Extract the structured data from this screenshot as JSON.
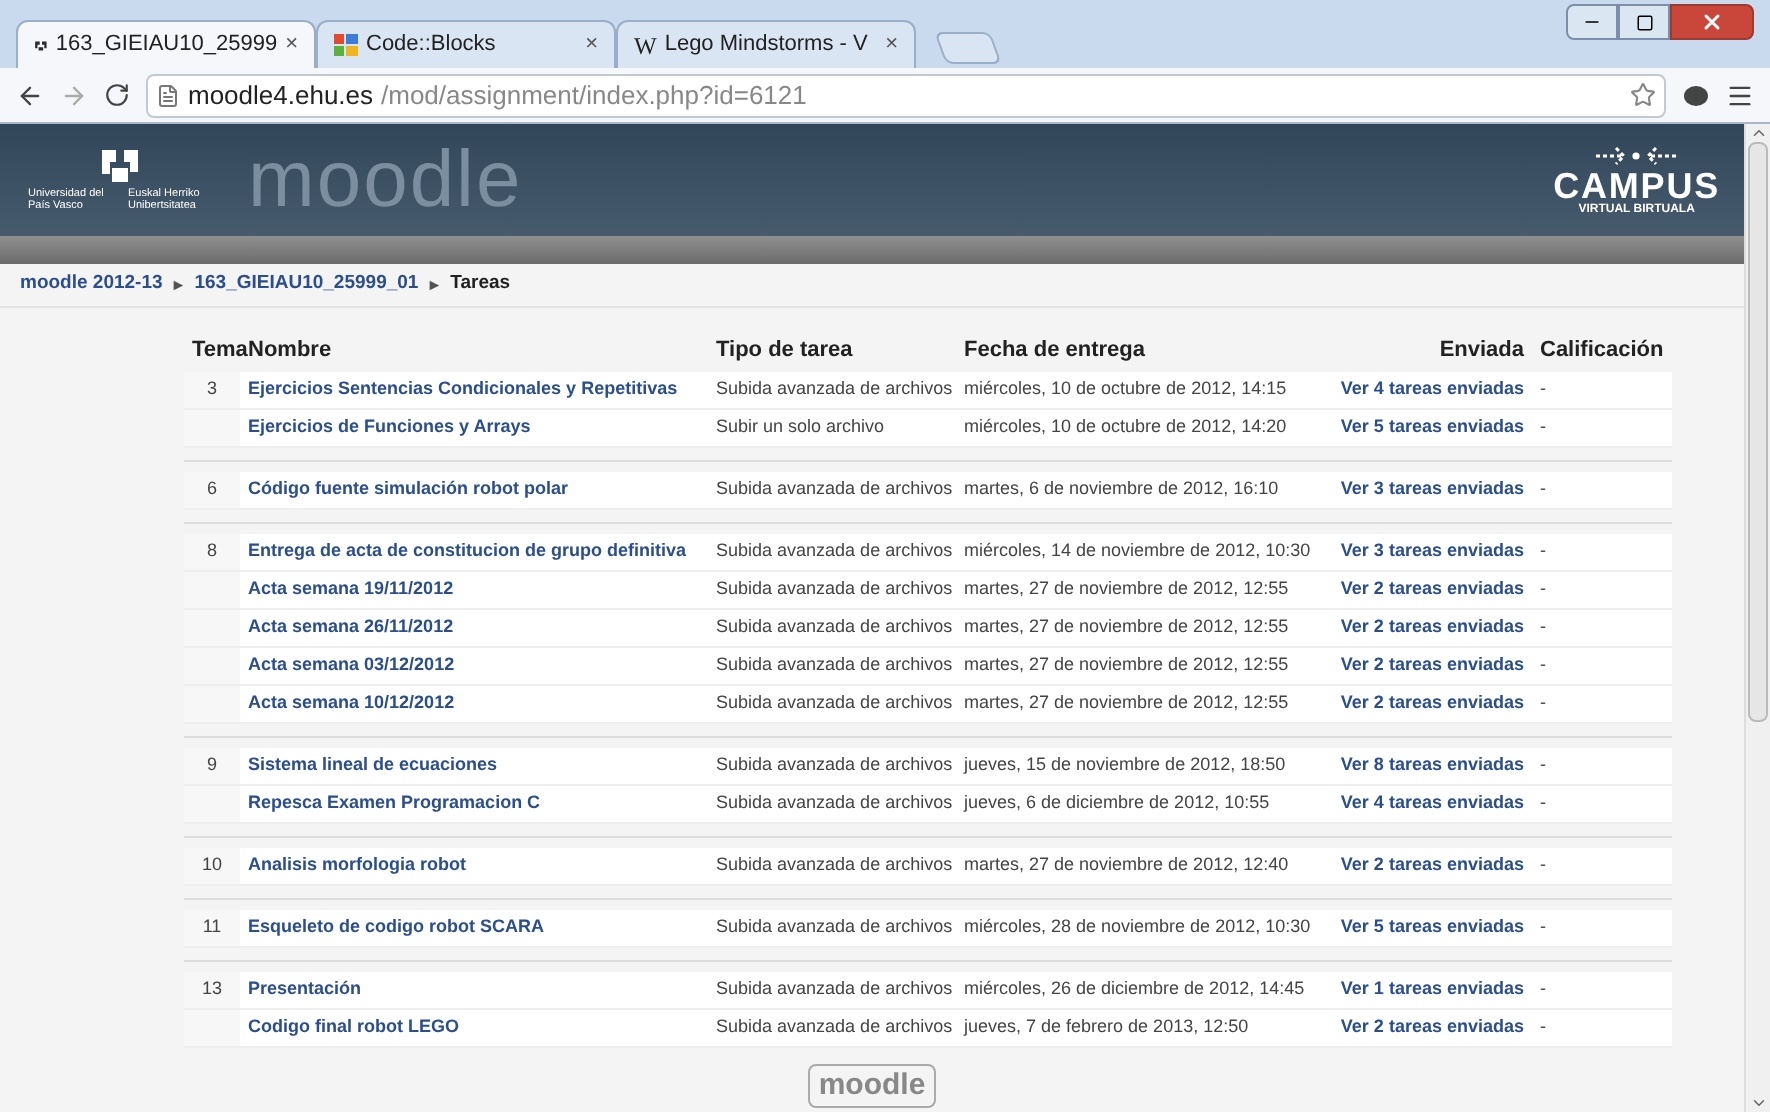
{
  "browser": {
    "tabs": [
      {
        "title": "163_GIEIAU10_25999",
        "close": "×",
        "selected": true,
        "kind": "moodle"
      },
      {
        "title": "Code::Blocks",
        "close": "×",
        "selected": false,
        "kind": "grid"
      },
      {
        "title": "Lego Mindstorms - V",
        "close": "×",
        "selected": false,
        "kind": "wiki"
      }
    ],
    "wiki_glyph": "W",
    "url_host": "moodle4.ehu.es",
    "url_path": "/mod/assignment/index.php?id=6121"
  },
  "header": {
    "university": [
      "Universidad del País Vasco",
      "Euskal Herriko Unibertsitatea"
    ],
    "site_name": "moodle",
    "campus": "CAMPUS",
    "campus_sub": "VIRTUAL BIRTUALA"
  },
  "breadcrumb": {
    "separator": "►",
    "items": [
      "moodle 2012-13",
      "163_GIEIAU10_25999_01",
      "Tareas"
    ]
  },
  "table": {
    "columns": [
      "Tema",
      "Nombre",
      "Tipo de tarea",
      "Fecha de entrega",
      "Enviada",
      "Calificación"
    ],
    "sections": [
      {
        "tema": "3",
        "rows": [
          {
            "name": "Ejercicios Sentencias Condicionales y Repetitivas",
            "type": "Subida avanzada de archivos",
            "due": "miércoles, 10 de octubre de 2012, 14:15",
            "sent": "Ver 4 tareas enviadas",
            "grade": "-"
          },
          {
            "name": "Ejercicios de Funciones y Arrays",
            "type": "Subir un solo archivo",
            "due": "miércoles, 10 de octubre de 2012, 14:20",
            "sent": "Ver 5 tareas enviadas",
            "grade": "-"
          }
        ]
      },
      {
        "tema": "6",
        "rows": [
          {
            "name": "Código fuente simulación robot polar",
            "type": "Subida avanzada de archivos",
            "due": "martes, 6 de noviembre de 2012, 16:10",
            "sent": "Ver 3 tareas enviadas",
            "grade": "-"
          }
        ]
      },
      {
        "tema": "8",
        "rows": [
          {
            "name": "Entrega de acta de constitucion de grupo definitiva",
            "type": "Subida avanzada de archivos",
            "due": "miércoles, 14 de noviembre de 2012, 10:30",
            "sent": "Ver 3 tareas enviadas",
            "grade": "-"
          },
          {
            "name": "Acta semana 19/11/2012",
            "type": "Subida avanzada de archivos",
            "due": "martes, 27 de noviembre de 2012, 12:55",
            "sent": "Ver 2 tareas enviadas",
            "grade": "-"
          },
          {
            "name": "Acta semana 26/11/2012",
            "type": "Subida avanzada de archivos",
            "due": "martes, 27 de noviembre de 2012, 12:55",
            "sent": "Ver 2 tareas enviadas",
            "grade": "-"
          },
          {
            "name": "Acta semana 03/12/2012",
            "type": "Subida avanzada de archivos",
            "due": "martes, 27 de noviembre de 2012, 12:55",
            "sent": "Ver 2 tareas enviadas",
            "grade": "-"
          },
          {
            "name": "Acta semana 10/12/2012",
            "type": "Subida avanzada de archivos",
            "due": "martes, 27 de noviembre de 2012, 12:55",
            "sent": "Ver 2 tareas enviadas",
            "grade": "-"
          }
        ]
      },
      {
        "tema": "9",
        "rows": [
          {
            "name": "Sistema lineal de ecuaciones",
            "type": "Subida avanzada de archivos",
            "due": "jueves, 15 de noviembre de 2012, 18:50",
            "sent": "Ver 8 tareas enviadas",
            "grade": "-"
          },
          {
            "name": "Repesca Examen Programacion C",
            "type": "Subida avanzada de archivos",
            "due": "jueves, 6 de diciembre de 2012, 10:55",
            "sent": "Ver 4 tareas enviadas",
            "grade": "-"
          }
        ]
      },
      {
        "tema": "10",
        "rows": [
          {
            "name": "Analisis morfologia robot",
            "type": "Subida avanzada de archivos",
            "due": "martes, 27 de noviembre de 2012, 12:40",
            "sent": "Ver 2 tareas enviadas",
            "grade": "-"
          }
        ]
      },
      {
        "tema": "11",
        "rows": [
          {
            "name": "Esqueleto de codigo robot SCARA",
            "type": "Subida avanzada de archivos",
            "due": "miércoles, 28 de noviembre de 2012, 10:30",
            "sent": "Ver 5 tareas enviadas",
            "grade": "-"
          }
        ]
      },
      {
        "tema": "13",
        "rows": [
          {
            "name": "Presentación",
            "type": "Subida avanzada de archivos",
            "due": "miércoles, 26 de diciembre de 2012, 14:45",
            "sent": "Ver 1 tareas enviadas",
            "grade": "-"
          },
          {
            "name": "Codigo final robot LEGO",
            "type": "Subida avanzada de archivos",
            "due": "jueves, 7 de febrero de 2013, 12:50",
            "sent": "Ver 2 tareas enviadas",
            "grade": "-"
          }
        ]
      }
    ]
  },
  "footer": {
    "logo": "moodle"
  }
}
